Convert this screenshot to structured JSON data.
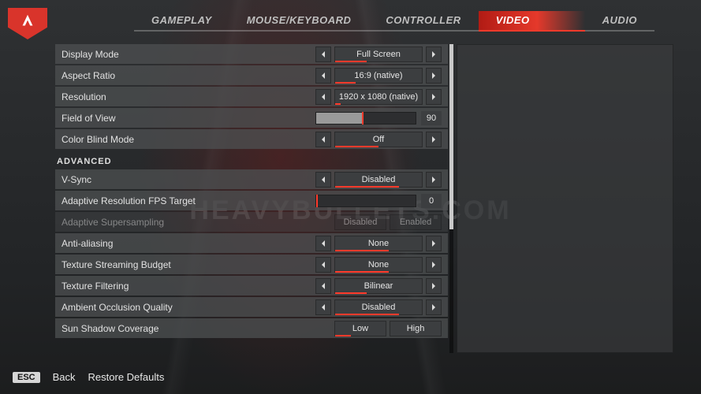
{
  "watermark": "HEAVYBULLETS.COM",
  "tabs": [
    {
      "label": "GAMEPLAY"
    },
    {
      "label": "MOUSE/KEYBOARD"
    },
    {
      "label": "CONTROLLER"
    },
    {
      "label": "VIDEO",
      "active": true
    },
    {
      "label": "AUDIO"
    }
  ],
  "section_advanced": "ADVANCED",
  "rows": {
    "display_mode": {
      "label": "Display Mode",
      "value": "Full Screen",
      "orange": 36
    },
    "aspect_ratio": {
      "label": "Aspect Ratio",
      "value": "16:9 (native)",
      "orange": 24
    },
    "resolution": {
      "label": "Resolution",
      "value": "1920 x 1080 (native)",
      "orange": 6
    },
    "fov": {
      "label": "Field of View",
      "value": "90",
      "fill": 46,
      "tick": 46
    },
    "color_blind": {
      "label": "Color Blind Mode",
      "value": "Off",
      "orange": 50
    },
    "vsync": {
      "label": "V-Sync",
      "value": "Disabled",
      "orange": 74
    },
    "adaptive_fps": {
      "label": "Adaptive Resolution FPS Target",
      "value": "0",
      "fill": 0,
      "tick": 0
    },
    "adaptive_ss": {
      "label": "Adaptive Supersampling",
      "a": "Disabled",
      "b": "Enabled",
      "disabled": true
    },
    "aa": {
      "label": "Anti-aliasing",
      "value": "None",
      "orange": 62
    },
    "tex_stream": {
      "label": "Texture Streaming Budget",
      "value": "None",
      "orange": 62
    },
    "tex_filter": {
      "label": "Texture Filtering",
      "value": "Bilinear",
      "orange": 36
    },
    "ao": {
      "label": "Ambient Occlusion Quality",
      "value": "Disabled",
      "orange": 74
    },
    "sun_shadow": {
      "label": "Sun Shadow Coverage",
      "a": "Low",
      "b": "High",
      "a_orange": 32
    }
  },
  "footer": {
    "esc": "ESC",
    "back": "Back",
    "restore": "Restore Defaults"
  }
}
